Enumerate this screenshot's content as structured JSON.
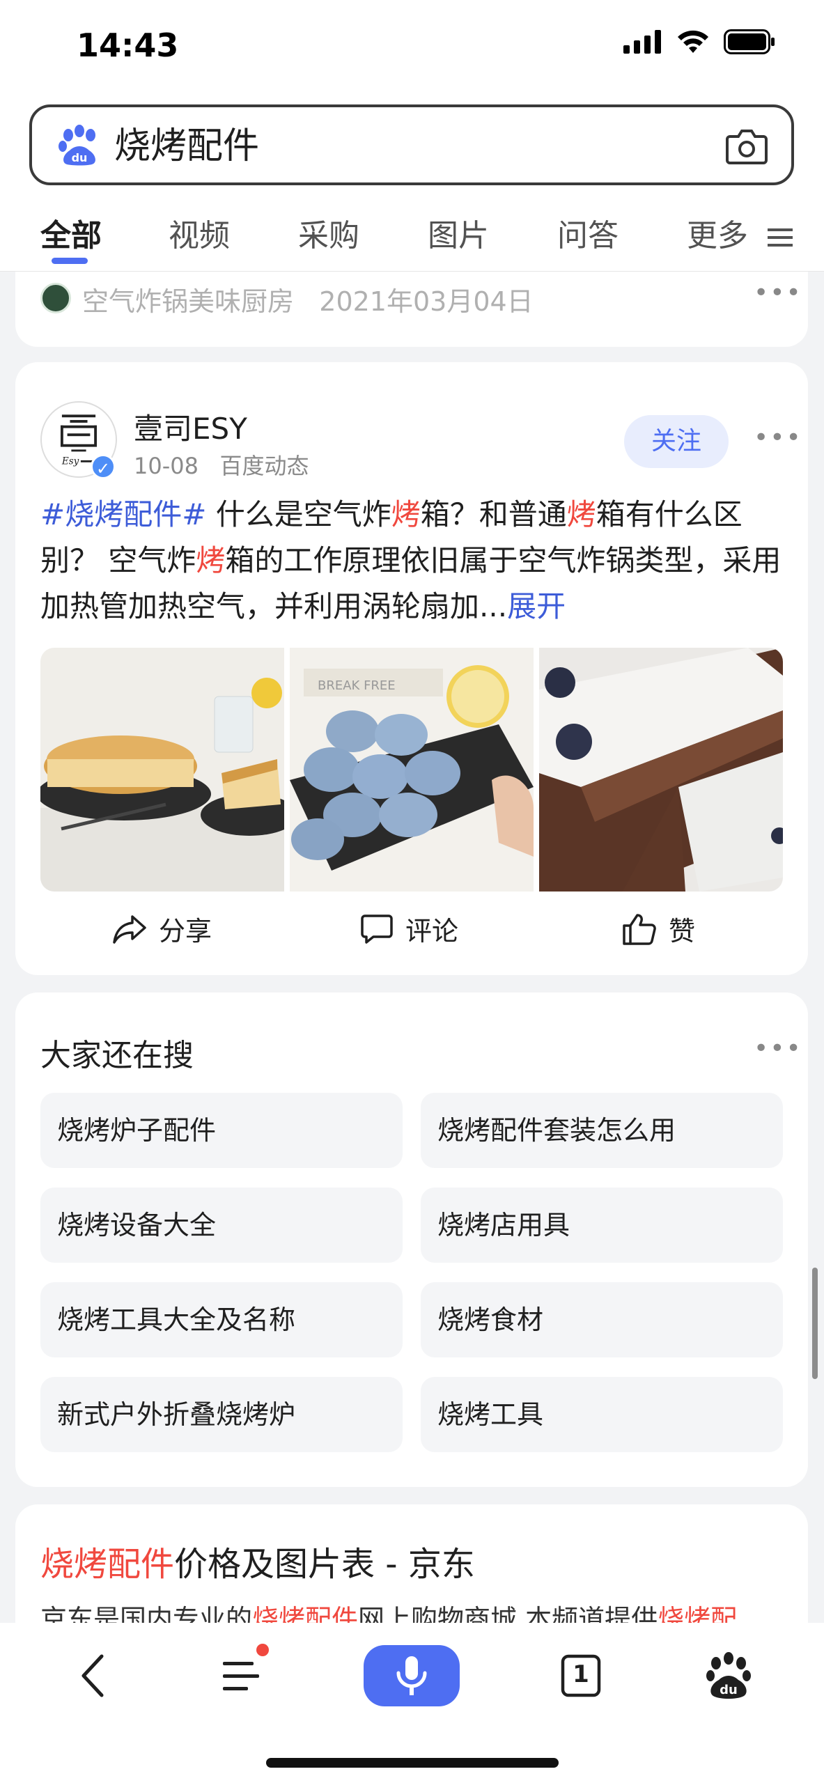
{
  "status_bar": {
    "time": "14:43"
  },
  "search": {
    "query": "烧烤配件"
  },
  "tabs": [
    {
      "label": "全部"
    },
    {
      "label": "视频"
    },
    {
      "label": "采购"
    },
    {
      "label": "图片"
    },
    {
      "label": "问答"
    },
    {
      "label": "更多"
    }
  ],
  "prev_card": {
    "source": "空气炸锅美味厨房",
    "date": "2021年03月04日"
  },
  "post": {
    "author": "壹司ESY",
    "date": "10-08",
    "source": "百度动态",
    "follow_label": "关注",
    "hashtag": "#烧烤配件#",
    "text_1": " 什么是空气炸",
    "hl_1": "烤",
    "text_2": "箱？和普通",
    "hl_2": "烤",
    "text_3": "箱有什么区别？ 空气炸",
    "hl_3": "烤",
    "text_4": "箱的工作原理依旧属于空气炸锅类型，采用加热管加热空气，并利用涡轮扇加",
    "ellipsis": "...",
    "expand_label": "展开",
    "actions": {
      "share": "分享",
      "comment": "评论",
      "like": "赞"
    }
  },
  "related": {
    "title": "大家还在搜",
    "items": [
      "烧烤炉子配件",
      "烧烤配件套装怎么用",
      "烧烤设备大全",
      "烧烤店用具",
      "烧烤工具大全及名称",
      "烧烤食材",
      "新式户外折叠烧烤炉",
      "烧烤工具"
    ]
  },
  "result": {
    "title_hl": "烧烤配件",
    "title_rest": "价格及图片表 - 京东",
    "snippet_1": "京东是国内专业的",
    "snippet_hl_1": "烧烤配件",
    "snippet_2": "网上购物商城,本频道提供",
    "snippet_hl_2": "烧烤配"
  },
  "bottom_nav": {
    "tab_count": "1"
  },
  "colors": {
    "accent": "#4e6ef2",
    "highlight": "#f0483e"
  }
}
